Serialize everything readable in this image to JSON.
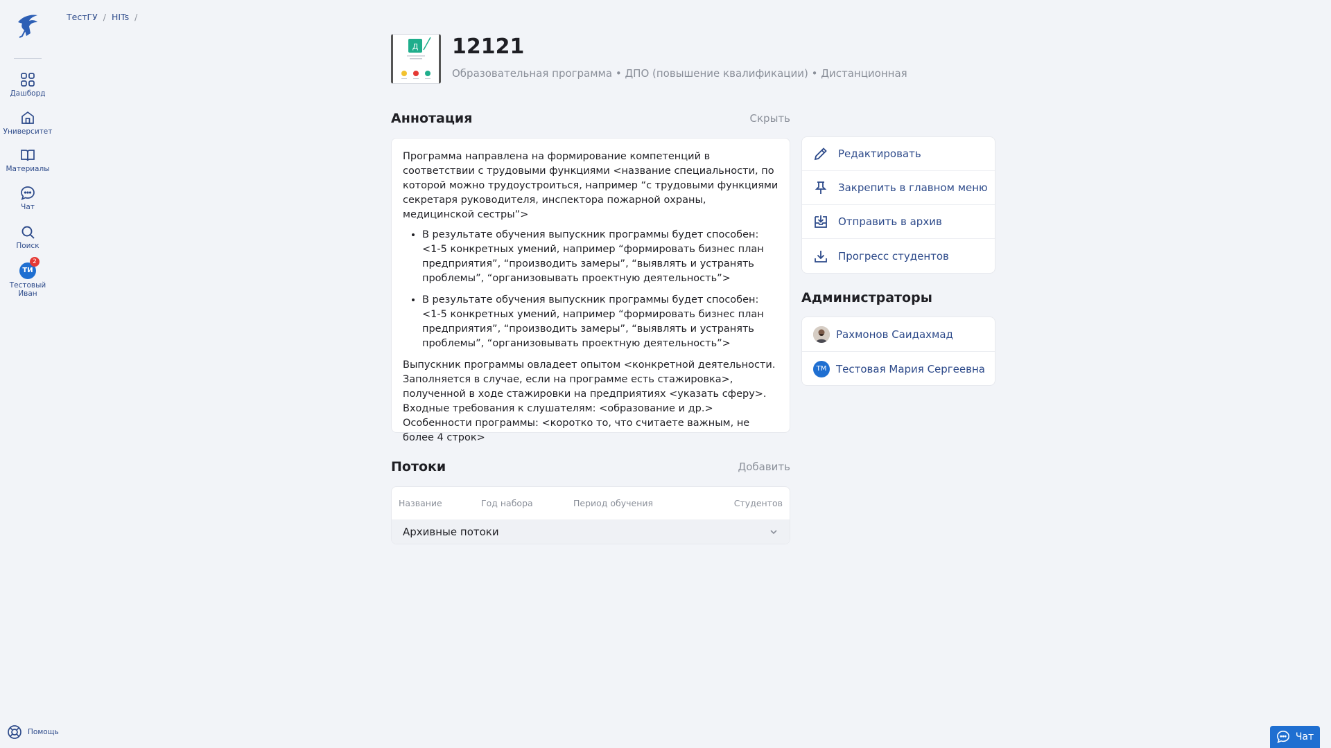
{
  "sidebar": {
    "items": [
      {
        "label": "Дашборд",
        "icon": "grid-icon"
      },
      {
        "label": "Университет",
        "icon": "home-icon"
      },
      {
        "label": "Материалы",
        "icon": "book-icon"
      },
      {
        "label": "Чат",
        "icon": "chat-icon"
      },
      {
        "label": "Поиск",
        "icon": "search-icon"
      }
    ],
    "user": {
      "initials": "ТИ",
      "name_line1": "Тестовый",
      "name_line2": "Иван",
      "notifications": "2"
    },
    "help_label": "Помощь"
  },
  "breadcrumb": {
    "items": [
      "ТестГУ",
      "HITs"
    ],
    "separator": "/"
  },
  "program": {
    "title": "12121",
    "subtitle": "Образовательная программа • ДПО (повышение квалификации) • Дистанционная",
    "cover_letter": "Д"
  },
  "annotation": {
    "title": "Аннотация",
    "toggle_label": "Скрыть",
    "paragraph1": "Программа направлена на формирование компетенций в соответствии с трудовыми функциями <название специальности, по которой можно трудоустроиться, например “с трудовыми функциями секретаря руководителя, инспектора пожарной охраны, медицинской сестры”>",
    "bullets": [
      "В результате обучения выпускник программы будет способен: <1-5 конкретных умений, например “формировать бизнес план предприятия”, “производить замеры”, “выявлять и устранять проблемы”, “организовывать проектную деятельность”>",
      "В результате обучения выпускник программы будет способен: <1-5 конкретных умений, например “формировать бизнес план предприятия”, “производить замеры”, “выявлять и устранять проблемы”, “организовывать проектную деятельность”>"
    ],
    "paragraph2": "Выпускник программы овладеет опытом <конкретной деятельности. Заполняется в случае, если на программе есть стажировка>, полученной в ходе стажировки на предприятиях <указать сферу>. Входные требования к слушателям: <образование и др.> Особенности программы: <коротко то, что считаете важным, не более 4 строк>"
  },
  "actions": [
    {
      "label": "Редактировать",
      "icon": "pencil-icon"
    },
    {
      "label": "Закрепить в главном меню",
      "icon": "pin-icon"
    },
    {
      "label": "Отправить в архив",
      "icon": "archive-icon"
    },
    {
      "label": "Прогресс студентов",
      "icon": "download-icon"
    }
  ],
  "admins": {
    "title": "Администраторы",
    "list": [
      {
        "name": "Рахмонов Саидахмад",
        "initials": ""
      },
      {
        "name": "Тестовая Мария Сергеевна",
        "initials": "ТМ"
      }
    ]
  },
  "streams": {
    "title": "Потоки",
    "add_label": "Добавить",
    "columns": [
      "Название",
      "Год набора",
      "Период обучения",
      "Студентов"
    ],
    "archived_label": "Архивные потоки"
  },
  "chat_button": {
    "label": "Чат"
  },
  "colors": {
    "accent": "#1f6fd1",
    "link": "#2d4a8a",
    "background": "#f2f4f8",
    "badge": "#e53935"
  }
}
